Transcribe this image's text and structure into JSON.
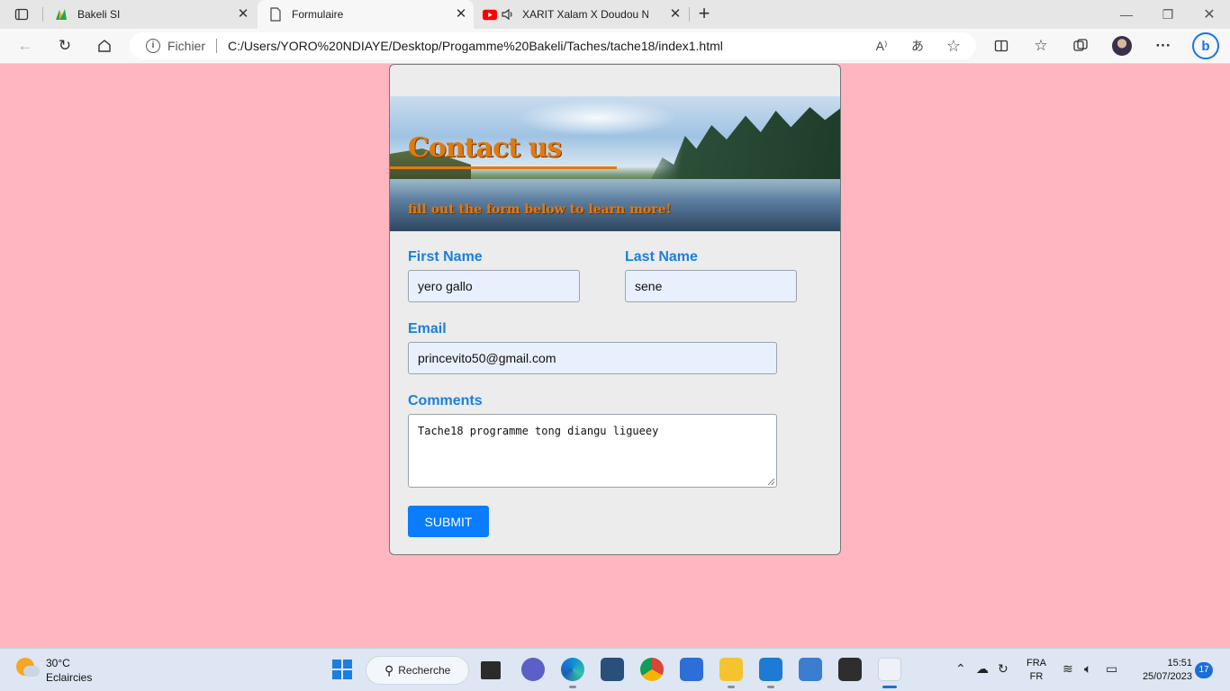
{
  "browser": {
    "tabs": [
      {
        "label": "Bakeli SI"
      },
      {
        "label": "Formulaire"
      },
      {
        "label": "XARIT Xalam X Doudou Ndi"
      }
    ],
    "address": {
      "scheme_label": "Fichier",
      "url": "C:/Users/YORO%20NDIAYE/Desktop/Progamme%20Bakeli/Taches/tache18/index1.html"
    }
  },
  "page": {
    "hero": {
      "title": "Contact us",
      "subtitle": "fill out the form below to learn more!"
    },
    "form": {
      "first_name_label": "First Name",
      "first_name_value": "yero gallo",
      "last_name_label": "Last Name",
      "last_name_value": "sene",
      "email_label": "Email",
      "email_value": "princevito50@gmail.com",
      "comments_label": "Comments",
      "comments_value": "Tache18 programme tong diangu ligueey",
      "submit_label": "SUBMIT"
    },
    "background_color": "#ffb6c1",
    "accent_color": "#1a7fe0",
    "button_color": "#0a7cff",
    "hero_text_color": "#e07a10"
  },
  "taskbar": {
    "weather": {
      "temp": "30°C",
      "desc": "Eclaircies"
    },
    "search_label": "Recherche",
    "lang": {
      "line1": "FRA",
      "line2": "FR"
    },
    "clock": {
      "time": "15:51",
      "date": "25/07/2023"
    },
    "notification_count": "17",
    "pinned_icons": [
      "start-icon",
      "search-icon",
      "task-view-icon",
      "teams-icon",
      "edge-icon",
      "virtualbox-icon",
      "chrome-icon",
      "store-icon",
      "file-explorer-icon",
      "vscode-icon",
      "notepad-icon",
      "terminal-icon",
      "snipping-tool-icon"
    ]
  }
}
